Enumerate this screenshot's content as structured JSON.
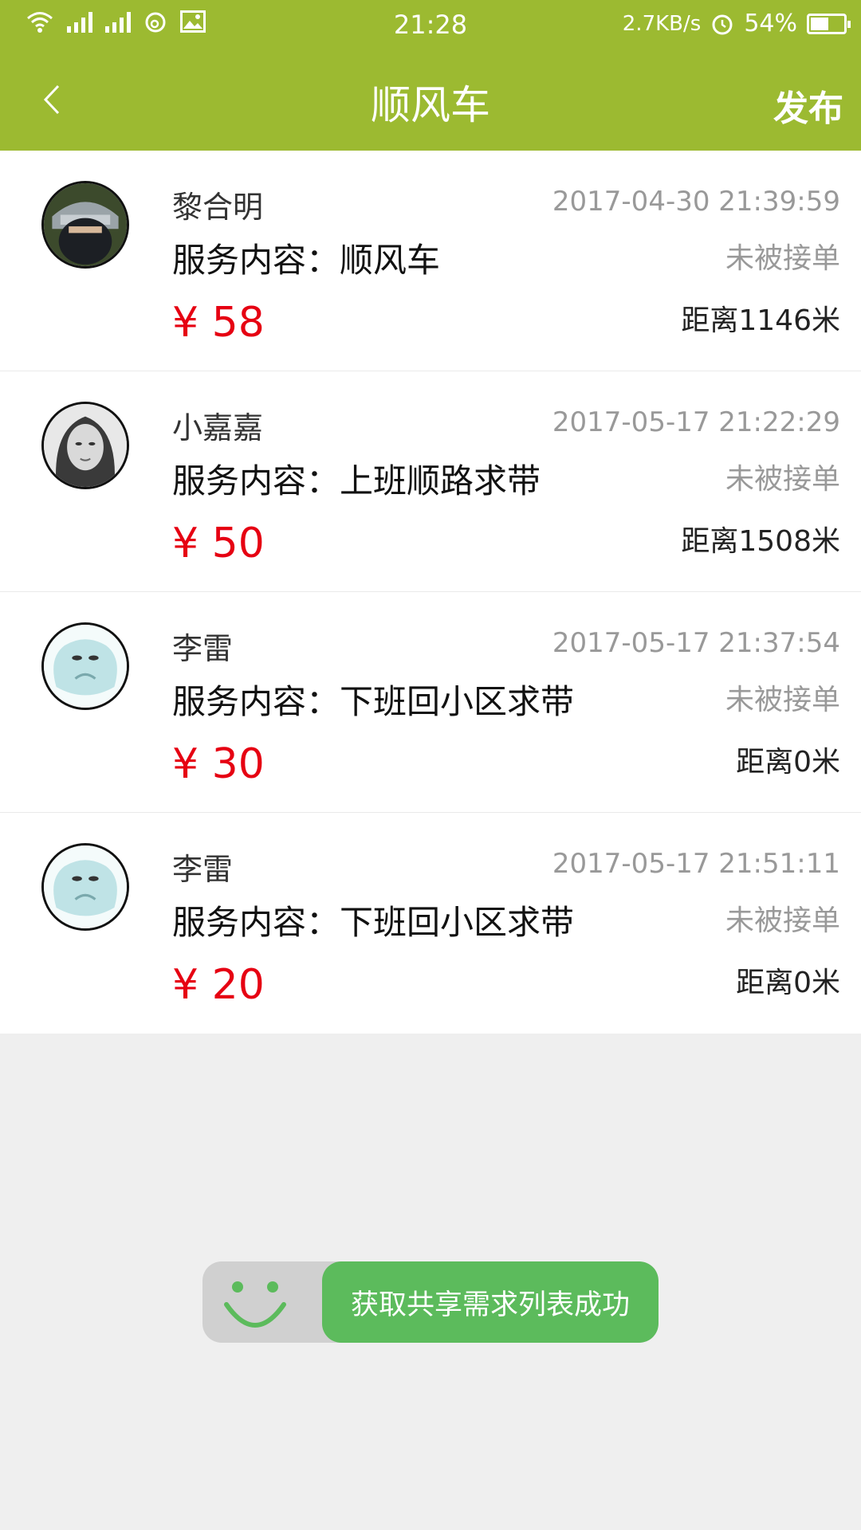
{
  "status_bar": {
    "time": "21:28",
    "speed": "2.7KB/s",
    "battery": "54%",
    "battery_level": 0.54,
    "icons": [
      "wifi-icon",
      "signal-icon",
      "signal-icon",
      "weibo-icon",
      "image-icon",
      "alarm-icon",
      "battery-icon"
    ]
  },
  "header": {
    "back_icon": "chevron-left-icon",
    "title": "顺风车",
    "publish_label": "发布"
  },
  "items": [
    {
      "name": "黎合明",
      "service": "服务内容：顺风车",
      "price": "¥ 58",
      "time": "2017-04-30 21:39:59",
      "status": "未被接单",
      "distance": "距离1146米",
      "avatar": "ninja-avatar"
    },
    {
      "name": "小嘉嘉",
      "service": "服务内容：上班顺路求带",
      "price": "¥ 50",
      "time": "2017-05-17 21:22:29",
      "status": "未被接单",
      "distance": "距离1508米",
      "avatar": "woman-avatar"
    },
    {
      "name": "李雷",
      "service": "服务内容：下班回小区求带",
      "price": "¥ 30",
      "time": "2017-05-17 21:37:54",
      "status": "未被接单",
      "distance": "距离0米",
      "avatar": "cartoon-avatar"
    },
    {
      "name": "李雷",
      "service": "服务内容：下班回小区求带",
      "price": "¥ 20",
      "time": "2017-05-17 21:51:11",
      "status": "未被接单",
      "distance": "距离0米",
      "avatar": "cartoon-avatar"
    }
  ],
  "toast": {
    "message": "获取共享需求列表成功",
    "icon": "smile-icon"
  },
  "colors": {
    "header_bg": "#9cba31",
    "price": "#e60012",
    "toast_bg": "#5cbb5c"
  }
}
